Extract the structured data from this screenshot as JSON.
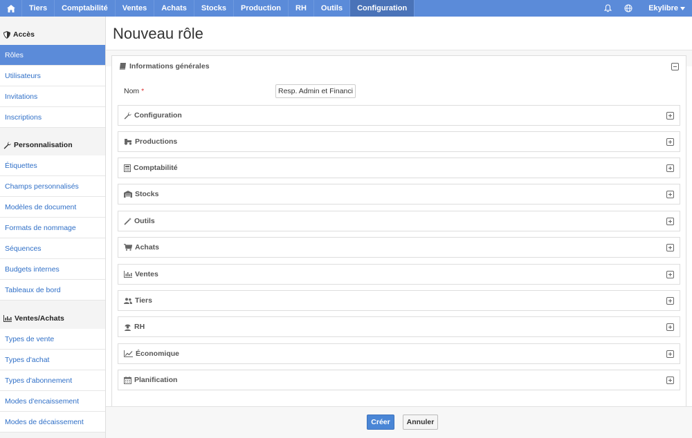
{
  "topnav": {
    "items": [
      {
        "label": "Tiers"
      },
      {
        "label": "Comptabilité"
      },
      {
        "label": "Ventes"
      },
      {
        "label": "Achats"
      },
      {
        "label": "Stocks"
      },
      {
        "label": "Production"
      },
      {
        "label": "RH"
      },
      {
        "label": "Outils"
      },
      {
        "label": "Configuration",
        "active": true
      }
    ],
    "user": "Ekylibre",
    "accent": "#5b8bd9"
  },
  "sidebar": {
    "sections": [
      {
        "title": "Accès",
        "icon": "shield-icon",
        "items": [
          "Rôles",
          "Utilisateurs",
          "Invitations",
          "Inscriptions"
        ]
      },
      {
        "title": "Personnalisation",
        "icon": "wrench-icon",
        "items": [
          "Étiquettes",
          "Champs personnalisés",
          "Modèles de document",
          "Formats de nommage",
          "Séquences",
          "Budgets internes",
          "Tableaux de bord"
        ]
      },
      {
        "title": "Ventes/Achats",
        "icon": "bar-chart-icon",
        "items": [
          "Types de vente",
          "Types d'achat",
          "Types d'abonnement",
          "Modes d'encaissement",
          "Modes de décaissement"
        ]
      }
    ],
    "active_item": "Rôles"
  },
  "main": {
    "title": "Nouveau rôle",
    "panel_title": "Informations générales",
    "name_label": "Nom",
    "required_mark": "*",
    "name_value": "Resp. Admin et Financier",
    "sections": [
      {
        "label": "Configuration",
        "icon": "wrench-icon"
      },
      {
        "label": "Productions",
        "icon": "tractor-icon"
      },
      {
        "label": "Comptabilité",
        "icon": "calculator-icon"
      },
      {
        "label": "Stocks",
        "icon": "warehouse-icon"
      },
      {
        "label": "Outils",
        "icon": "magic-wand-icon"
      },
      {
        "label": "Achats",
        "icon": "cart-icon"
      },
      {
        "label": "Ventes",
        "icon": "bar-chart-icon"
      },
      {
        "label": "Tiers",
        "icon": "people-icon"
      },
      {
        "label": "RH",
        "icon": "worker-icon"
      },
      {
        "label": "Économique",
        "icon": "line-chart-icon"
      },
      {
        "label": "Planification",
        "icon": "calendar-icon"
      }
    ]
  },
  "footer": {
    "create_label": "Créer",
    "cancel_label": "Annuler"
  }
}
